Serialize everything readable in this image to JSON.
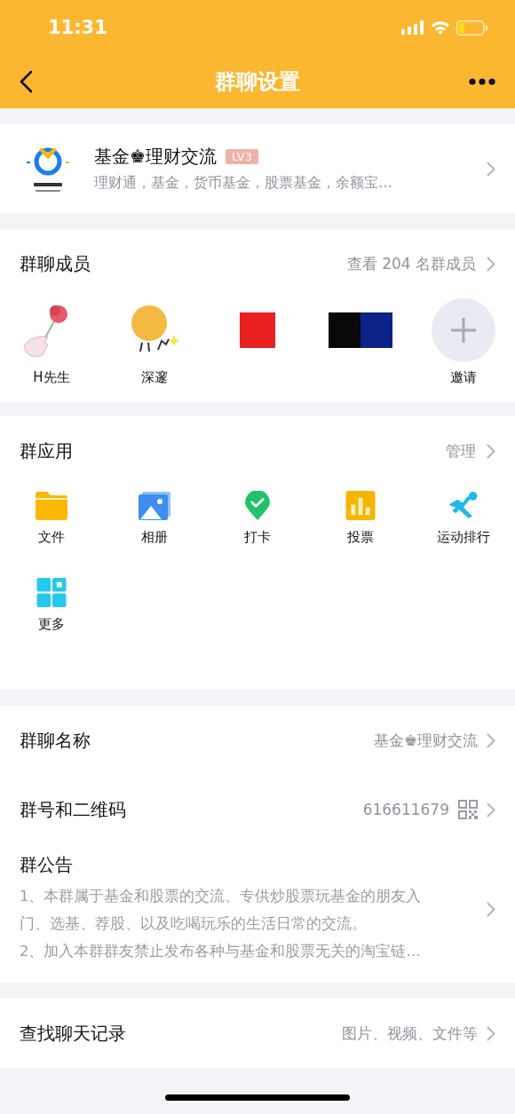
{
  "status_bar": {
    "time": "11:31"
  },
  "nav": {
    "title": "群聊设置"
  },
  "group": {
    "name": "基金♚理财交流",
    "level_badge": "LV3",
    "description": "理财通，基金，货币基金，股票基金，余额宝…"
  },
  "members": {
    "title": "群聊成员",
    "link": "查看 204 名群成员",
    "items": [
      {
        "kind": "rose",
        "name": "H先生"
      },
      {
        "kind": "smiley",
        "name": "深邃"
      },
      {
        "kind": "red"
      },
      {
        "kind": "black-blue"
      },
      {
        "kind": "invite",
        "name": "邀请"
      }
    ]
  },
  "apps": {
    "title": "群应用",
    "action": "管理",
    "items": [
      {
        "kind": "folder",
        "label": "文件"
      },
      {
        "kind": "album",
        "label": "相册"
      },
      {
        "kind": "checkin",
        "label": "打卡"
      },
      {
        "kind": "vote",
        "label": "投票"
      },
      {
        "kind": "sport",
        "label": "运动排行"
      },
      {
        "kind": "more",
        "label": "更多"
      }
    ]
  },
  "settings": [
    {
      "kind": "value",
      "label": "群聊名称",
      "value": "基金♚理财交流"
    },
    {
      "kind": "qr",
      "label": "群号和二维码",
      "value": "616611679"
    },
    {
      "kind": "notice",
      "label": "群公告",
      "lines": [
        "1、本群属于基金和股票的交流、专供炒股票玩基金的朋友入",
        "门、选基、荐股、以及吃喝玩乐的生活日常的交流。",
        "2、加入本群群友禁止发布各种与基金和股票无关的淘宝链…"
      ]
    }
  ],
  "search": {
    "label": "查找聊天记录",
    "value": "图片、视频、文件等"
  }
}
